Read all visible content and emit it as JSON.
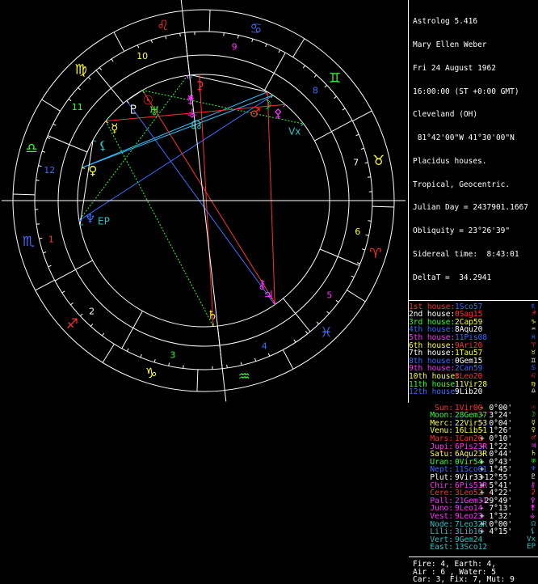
{
  "header": {
    "program": "Astrolog 5.416",
    "name": "Mary Ellen Weber",
    "date": "Fri 24 August 1962",
    "time": "16:00:00 (ST +0:00 GMT)",
    "place": "Cleveland (OH)",
    "coords": " 81°42'00\"W 41°30'00\"N",
    "houses": "Placidus houses.",
    "zodiac": "Tropical, Geocentric.",
    "julian": "Julian Day = 2437901.1667",
    "obliquity": "Obliquity = 23°26'39\"",
    "sidereal": "Sidereal time:  8:43:01",
    "deltat": "DeltaT =  34.2941"
  },
  "houses": [
    {
      "label": "1st house:",
      "value": "1Sco57",
      "glyph": "♏",
      "color": "#3b6cff",
      "label_color": "#ff3030"
    },
    {
      "label": "2nd house:",
      "value": "0Sag15",
      "glyph": "♐",
      "color": "#ff3030",
      "label_color": "#ffffff"
    },
    {
      "label": "3rd house:",
      "value": "2Cap59",
      "glyph": "♑",
      "color": "#ffff30",
      "label_color": "#30ff30"
    },
    {
      "label": "4th house:",
      "value": "8Aqu20",
      "glyph": "♒",
      "color": "#ffffff",
      "label_color": "#3b6cff"
    },
    {
      "label": "5th house:",
      "value": "11Pis08",
      "glyph": "♓",
      "color": "#3b6cff",
      "label_color": "#ff30ff"
    },
    {
      "label": "6th house:",
      "value": "9Ari20",
      "glyph": "♈",
      "color": "#ff3030",
      "label_color": "#ffff30"
    },
    {
      "label": "7th house:",
      "value": "1Tau57",
      "glyph": "♉",
      "color": "#ffff30",
      "label_color": "#ffffff"
    },
    {
      "label": "8th house:",
      "value": "0Gem15",
      "glyph": "♊",
      "color": "#ffffff",
      "label_color": "#3b6cff"
    },
    {
      "label": "9th house:",
      "value": "2Can59",
      "glyph": "♋",
      "color": "#3b6cff",
      "label_color": "#ff30ff"
    },
    {
      "label": "10th house:",
      "value": "8Leo20",
      "glyph": "♌",
      "color": "#ff3030",
      "label_color": "#ffff30"
    },
    {
      "label": "11th house:",
      "value": "11Vir28",
      "glyph": "♍",
      "color": "#ffff30",
      "label_color": "#30ff30"
    },
    {
      "label": "12th house:",
      "value": "9Lib20",
      "glyph": "♎",
      "color": "#ffffff",
      "label_color": "#3b6cff"
    }
  ],
  "planets": [
    {
      "label": "Sun:",
      "value": "1Vir00",
      "ext": "- 0°00'",
      "glyph": "☉",
      "color": "#ff3030"
    },
    {
      "label": "Moon:",
      "value": "28Gem37",
      "ext": "- 3°24'",
      "glyph": "☽",
      "color": "#30ff30"
    },
    {
      "label": "Merc:",
      "value": "22Vir53",
      "ext": "- 0°04'",
      "glyph": "☿",
      "color": "#ffff30"
    },
    {
      "label": "Venu:",
      "value": "16Lib51",
      "ext": "- 1°26'",
      "glyph": "♀",
      "color": "#ffff30"
    },
    {
      "label": "Mars:",
      "value": "1Can26",
      "ext": "+ 0°10'",
      "glyph": "♂",
      "color": "#ff3030"
    },
    {
      "label": "Jupi:",
      "value": "6Pis23R",
      "ext": "- 1°22'",
      "glyph": "♃",
      "color": "#ff30ff"
    },
    {
      "label": "Satu:",
      "value": "6Aqu23R",
      "ext": "- 0°44'",
      "glyph": "♄",
      "color": "#ffff30"
    },
    {
      "label": "Uran:",
      "value": "0Vir54",
      "ext": "+ 0°43'",
      "glyph": "♅",
      "color": "#30ff30"
    },
    {
      "label": "Nept:",
      "value": "11Sco01",
      "ext": "+ 1°45'",
      "glyph": "♆",
      "color": "#3b6cff"
    },
    {
      "label": "Plut:",
      "value": "9Vir33",
      "ext": "+12°55'",
      "glyph": "♇",
      "color": "#ffffff"
    },
    {
      "label": "Chir:",
      "value": "6Pis51R",
      "ext": "+ 5°41'",
      "glyph": "⚷",
      "color": "#ff30ff"
    },
    {
      "label": "Cere:",
      "value": "3Leo52",
      "ext": "+ 4°22'",
      "glyph": "⚳",
      "color": "#ff3030"
    },
    {
      "label": "Pall:",
      "value": "21Gem31",
      "ext": "-29°49'",
      "glyph": "⚴",
      "color": "#ff30ff"
    },
    {
      "label": "Juno:",
      "value": "9Leo14",
      "ext": "- 7°13'",
      "glyph": "⚵",
      "color": "#ff30ff"
    },
    {
      "label": "Vest:",
      "value": "9Leo23",
      "ext": "+ 1°32'",
      "glyph": "⚶",
      "color": "#ff30ff"
    },
    {
      "label": "Node:",
      "value": "7Leo32R",
      "ext": "+ 0°00'",
      "glyph": "☊",
      "color": "#30c0c0"
    },
    {
      "label": "Lili:",
      "value": "3Lib16",
      "ext": "+ 4°15'",
      "glyph": "⚸",
      "color": "#30c0c0"
    },
    {
      "label": "Vert:",
      "value": "9Gem24",
      "ext": "",
      "glyph": "Vx",
      "color": "#30c0c0"
    },
    {
      "label": "East:",
      "value": "13Sco12",
      "ext": "",
      "glyph": "EP",
      "color": "#30c0c0"
    }
  ],
  "summary": {
    "line1": "Fire: 4, Earth: 4,",
    "line2": "Air : 6 , Water: 5",
    "line3": "Car: 3, Fix: 7, Mut: 9"
  },
  "wheel": {
    "asc_longitude": 211.95,
    "sign_glyphs": [
      "♈",
      "♉",
      "♊",
      "♋",
      "♌",
      "♍",
      "♎",
      "♏",
      "♐",
      "♑",
      "♒",
      "♓"
    ],
    "sign_colors": [
      "#ff3030",
      "#ffff30",
      "#30ff30",
      "#3b6cff",
      "#ff3030",
      "#ffff30",
      "#30ff30",
      "#3b6cff",
      "#ff3030",
      "#ffff30",
      "#30ff30",
      "#3b6cff"
    ],
    "house_cusps": [
      211.95,
      240.25,
      272.98,
      308.33,
      341.13,
      9.33,
      31.95,
      60.25,
      92.98,
      128.33,
      161.47,
      189.33
    ],
    "house_numbers": [
      "1",
      "2",
      "3",
      "4",
      "5",
      "6",
      "7",
      "8",
      "9",
      "10",
      "11",
      "12"
    ],
    "house_number_colors": [
      "#ff3030",
      "#ffffff",
      "#30ff30",
      "#3b6cff",
      "#ff30ff",
      "#ffff30",
      "#ffffff",
      "#3b6cff",
      "#ff30ff",
      "#ffff30",
      "#30ff30",
      "#3b6cff"
    ],
    "planet_longitudes": [
      151.0,
      88.62,
      172.88,
      196.85,
      91.43,
      336.38,
      306.38,
      150.9,
      221.02,
      159.55,
      336.85,
      123.87,
      81.52,
      129.23,
      129.38,
      127.53,
      183.27,
      69.4,
      223.2
    ],
    "aspects": [
      {
        "a": 0,
        "b": 9,
        "color": "#ffffff"
      },
      {
        "a": 1,
        "b": 8,
        "color": "#3b6cff"
      },
      {
        "a": 4,
        "b": 3,
        "color": "#30c0ff"
      },
      {
        "a": 2,
        "b": 6,
        "color": "#30ff30"
      },
      {
        "a": 5,
        "b": 4,
        "color": "#ff3030"
      },
      {
        "a": 0,
        "b": 17,
        "color": "#30ff30"
      },
      {
        "a": 7,
        "b": 10,
        "color": "#ff3030"
      },
      {
        "a": 9,
        "b": 5,
        "color": "#3b6cff"
      },
      {
        "a": 3,
        "b": 1,
        "color": "#30c0ff"
      },
      {
        "a": 11,
        "b": 6,
        "color": "#ff3030"
      },
      {
        "a": 12,
        "b": 2,
        "color": "#ff3030"
      },
      {
        "a": 13,
        "b": 8,
        "color": "#30ff30"
      },
      {
        "a": 18,
        "b": 16,
        "color": "#ffffff"
      },
      {
        "a": 15,
        "b": 4,
        "color": "#ffffff"
      }
    ]
  }
}
